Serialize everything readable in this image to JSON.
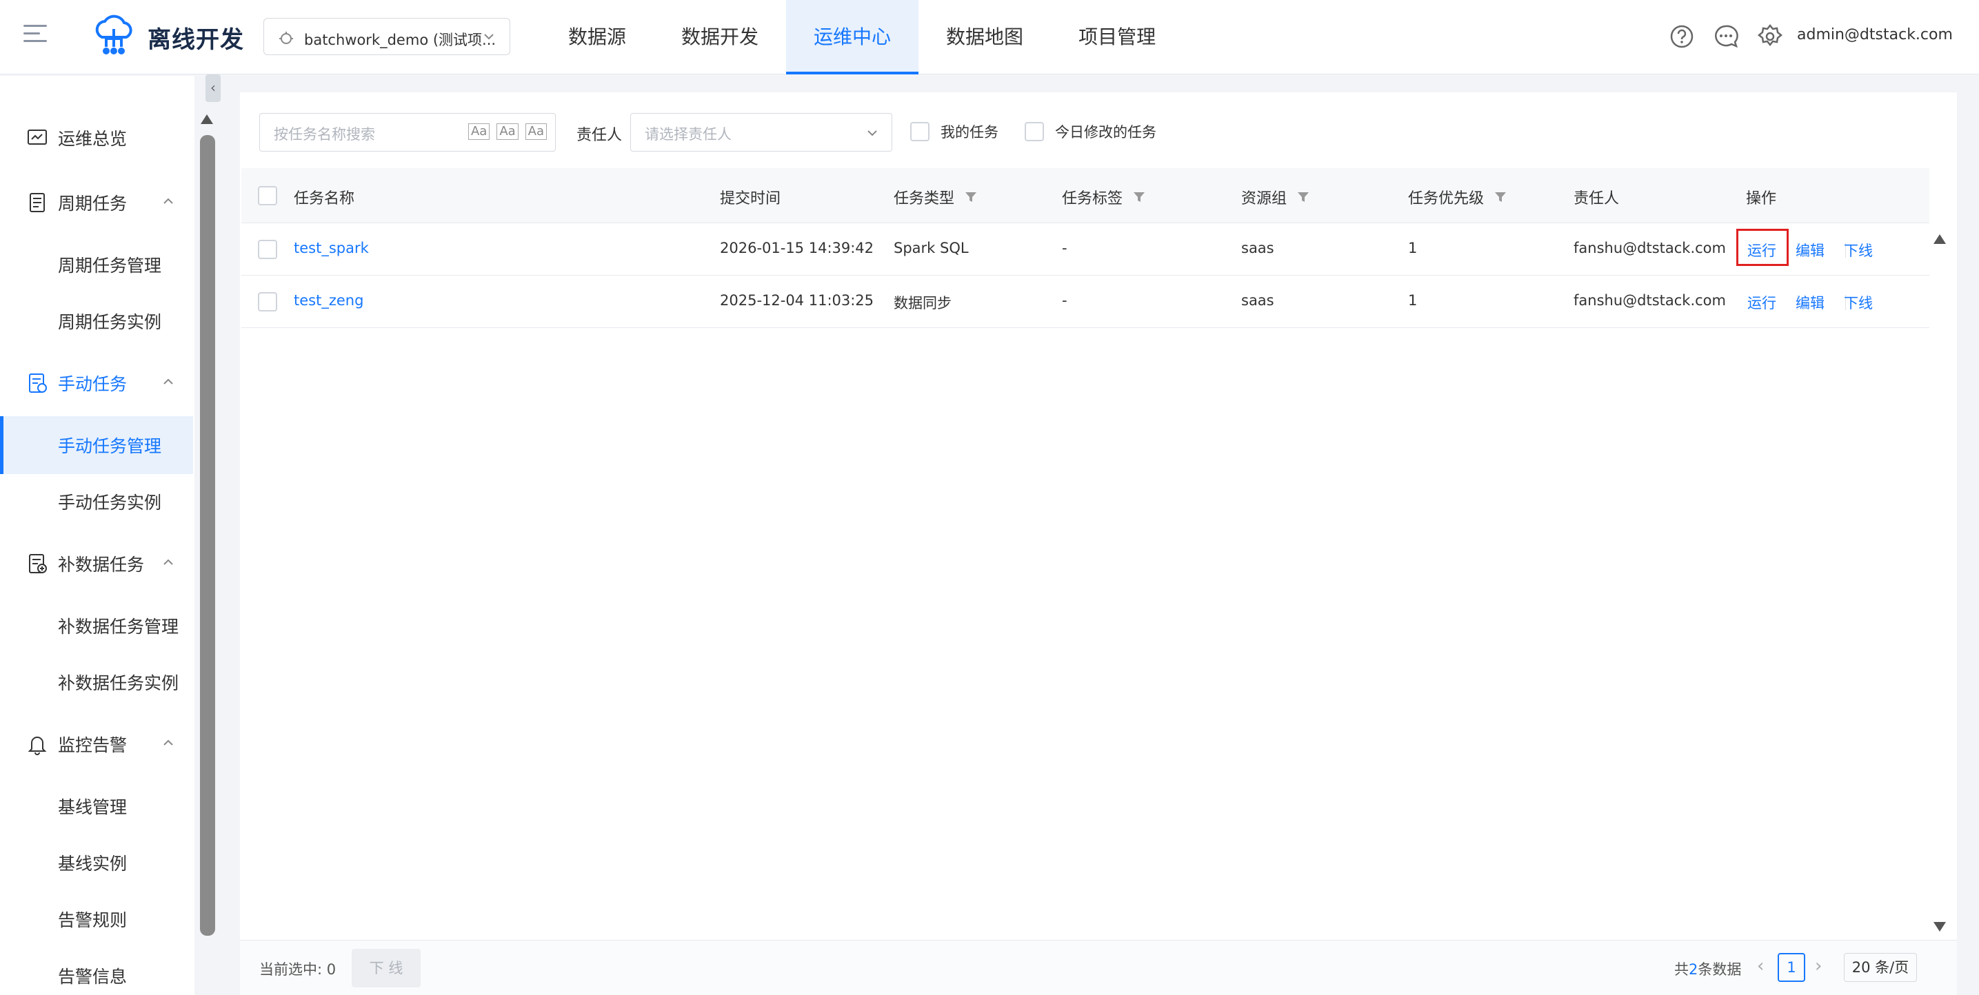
{
  "header": {
    "app_title": "离线开发",
    "project": "batchwork_demo (测试项...",
    "nav": [
      {
        "label": "数据源"
      },
      {
        "label": "数据开发"
      },
      {
        "label": "运维中心",
        "active": true
      },
      {
        "label": "数据地图"
      },
      {
        "label": "项目管理"
      }
    ],
    "icons": [
      "help-icon",
      "message-icon",
      "settings-icon"
    ],
    "user": "admin@dtstack.com"
  },
  "sidebar": {
    "overview": "运维总览",
    "periodic": "周期任务",
    "periodic_manage": "周期任务管理",
    "periodic_instance": "周期任务实例",
    "manual": "手动任务",
    "manual_manage": "手动任务管理",
    "manual_instance": "手动任务实例",
    "backfill": "补数据任务",
    "backfill_manage": "补数据任务管理",
    "backfill_instance": "补数据任务实例",
    "alert": "监控告警",
    "baseline_manage": "基线管理",
    "baseline_instance": "基线实例",
    "alert_rules": "告警规则",
    "alert_info": "告警信息"
  },
  "filters": {
    "search_placeholder": "按任务名称搜索",
    "search_opt1": "Aa",
    "search_opt2": "Aa",
    "search_opt3": "Aa",
    "owner_label": "责任人",
    "owner_placeholder": "请选择责任人",
    "my_tasks": "我的任务",
    "today_modified": "今日修改的任务"
  },
  "table": {
    "columns": {
      "name": "任务名称",
      "submit_time": "提交时间",
      "type": "任务类型",
      "tag": "任务标签",
      "resource": "资源组",
      "priority": "任务优先级",
      "owner": "责任人",
      "ops": "操作"
    },
    "rows": [
      {
        "name": "test_spark",
        "submit_time": "2026-01-15 14:39:42",
        "type": "Spark SQL",
        "tag": "-",
        "resource": "saas",
        "priority": "1",
        "owner": "fanshu@dtstack.com",
        "run": "运行",
        "edit": "编辑",
        "offline": "下线"
      },
      {
        "name": "test_zeng",
        "submit_time": "2025-12-04 11:03:25",
        "type": "数据同步",
        "tag": "-",
        "resource": "saas",
        "priority": "1",
        "owner": "fanshu@dtstack.com",
        "run": "运行",
        "edit": "编辑",
        "offline": "下线"
      }
    ]
  },
  "footer": {
    "selected_label": "当前选中: 0",
    "offline_button": "下 线",
    "total_prefix": "共",
    "total_count": "2",
    "total_suffix": "条数据",
    "current_page": "1",
    "page_size": "20 条/页"
  },
  "colors": {
    "primary": "#1677ff",
    "highlight_box": "#e02020"
  }
}
